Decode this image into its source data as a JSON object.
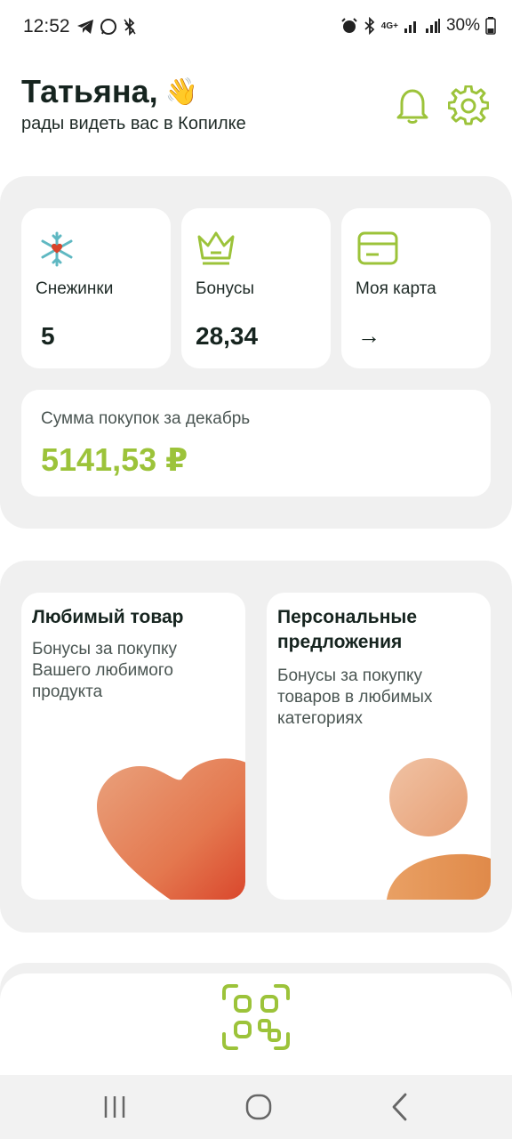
{
  "status_bar": {
    "time": "12:52",
    "battery": "30%",
    "network": "4G+"
  },
  "header": {
    "name": "Татьяна,",
    "subtitle": "рады видеть вас в Копилке",
    "wave_emoji": "👋",
    "icons": [
      "bell-icon",
      "gear-icon"
    ]
  },
  "tiles": [
    {
      "label": "Снежинки",
      "value": "5",
      "icon": "snowflake-icon"
    },
    {
      "label": "Бонусы",
      "value": "28,34",
      "icon": "crown-icon"
    },
    {
      "label": "Моя карта",
      "value": "→",
      "icon": "card-icon"
    }
  ],
  "purchases": {
    "label": "Сумма покупок за декабрь",
    "value": "5141,53 ₽"
  },
  "offers": [
    {
      "title": "Любимый товар",
      "description": "Бонусы за покупку Вашего любимого продукта"
    },
    {
      "title": "Персональные предложения",
      "description": "Бонусы за покупку товаров в любимых категориях"
    }
  ],
  "colors": {
    "accent": "#9cc33a",
    "panel": "#f0f0f0",
    "heart_top": "#e9a27d",
    "heart_bottom": "#d9442a"
  }
}
